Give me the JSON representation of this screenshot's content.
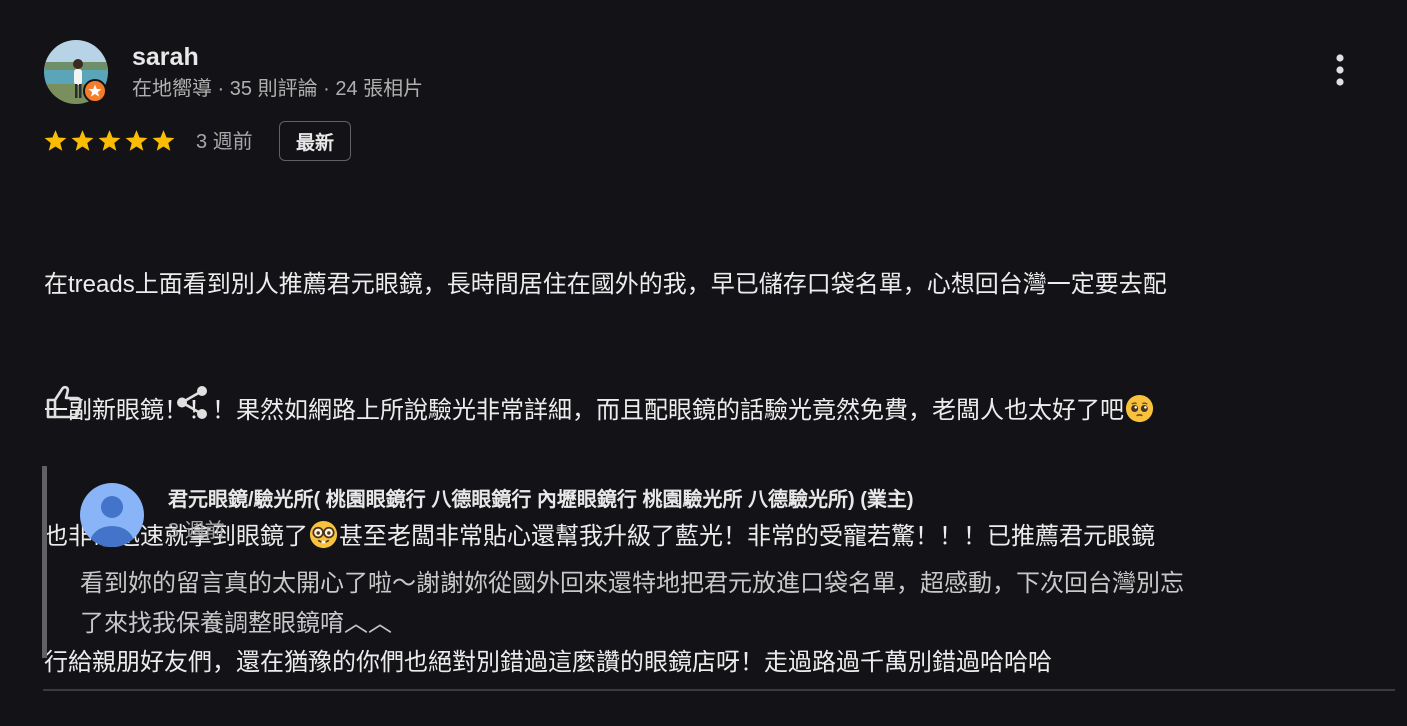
{
  "review": {
    "reviewer_name": "sarah",
    "reviewer_meta": "在地嚮導 · 35 則評論 · 24 張相片",
    "rating": 5,
    "star_color": "#fbbc04",
    "time": "3 週前",
    "newest_label": "最新",
    "text_lines": [
      "在treads上面看到別人推薦君元眼鏡，長時間居住在國外的我，早已儲存口袋名單，心想回台灣一定要去配",
      "一副新眼鏡！！！果然如網路上所說驗光非常詳細，而且配眼鏡的話驗光竟然免費，老闆人也太好了吧",
      "也非常迅速就拿到眼鏡了",
      "甚至老闆非常貼心還幫我升級了藍光！非常的受寵若驚！！！已推薦君元眼鏡",
      "行給親朋好友們，還在猶豫的你們也絕對別錯過這麼讚的眼鏡店呀！走過路過千萬別錯過哈哈哈"
    ],
    "emoji": [
      "pleading-face-emoji",
      "nerd-face-emoji"
    ]
  },
  "actions": {
    "like_icon": "thumbs-up-icon",
    "share_icon": "share-icon",
    "more_icon": "more-vert-icon"
  },
  "owner_reply": {
    "name": "君元眼鏡/驗光所( 桃園眼鏡行 八德眼鏡行 內壢眼鏡行 桃園驗光所 八德驗光所) (業主)",
    "time": "3 週前",
    "text_lines": [
      "看到妳的留言真的太開心了啦～謝謝妳從國外回來還特地把君元放進口袋名單，超感動，下次回台灣別忘",
      "了來找我保養調整眼鏡唷︿︿"
    ],
    "avatar_color": "#8ab4f8"
  },
  "colors": {
    "background": "#131317",
    "badge_orange": "#f57c2a"
  }
}
